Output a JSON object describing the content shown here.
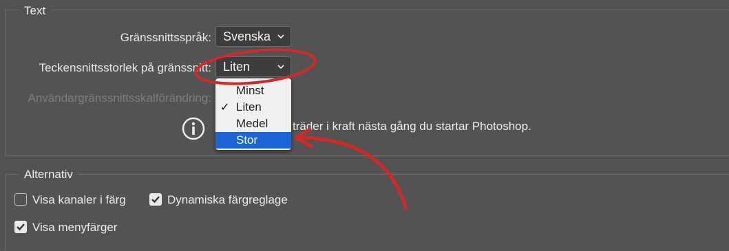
{
  "text_group": {
    "legend": "Text",
    "language_label": "Gränssnittsspråk:",
    "language_value": "Svenska",
    "font_size_label": "Teckensnittsstorlek på gränssnitt:",
    "font_size_value": "Liten",
    "scale_label": "Användargränssnittsskalförändring:",
    "restart_note": "träder i kraft nästa gång du startar Photoshop."
  },
  "font_size_options": [
    {
      "label": "Minst",
      "checked": false,
      "highlighted": false
    },
    {
      "label": "Liten",
      "checked": true,
      "highlighted": false
    },
    {
      "label": "Medel",
      "checked": false,
      "highlighted": false
    },
    {
      "label": "Stor",
      "checked": false,
      "highlighted": true
    }
  ],
  "check_glyph": "✓",
  "alt_group": {
    "legend": "Alternativ",
    "show_channels_color": {
      "label": "Visa kanaler i färg",
      "checked": false
    },
    "dynamic_sliders": {
      "label": "Dynamiska färgreglage",
      "checked": true
    },
    "menu_colors": {
      "label": "Visa menyfärger",
      "checked": true
    }
  },
  "colors": {
    "background": "#535353",
    "highlight": "#1a64d6",
    "annotation": "#cf2a27"
  }
}
